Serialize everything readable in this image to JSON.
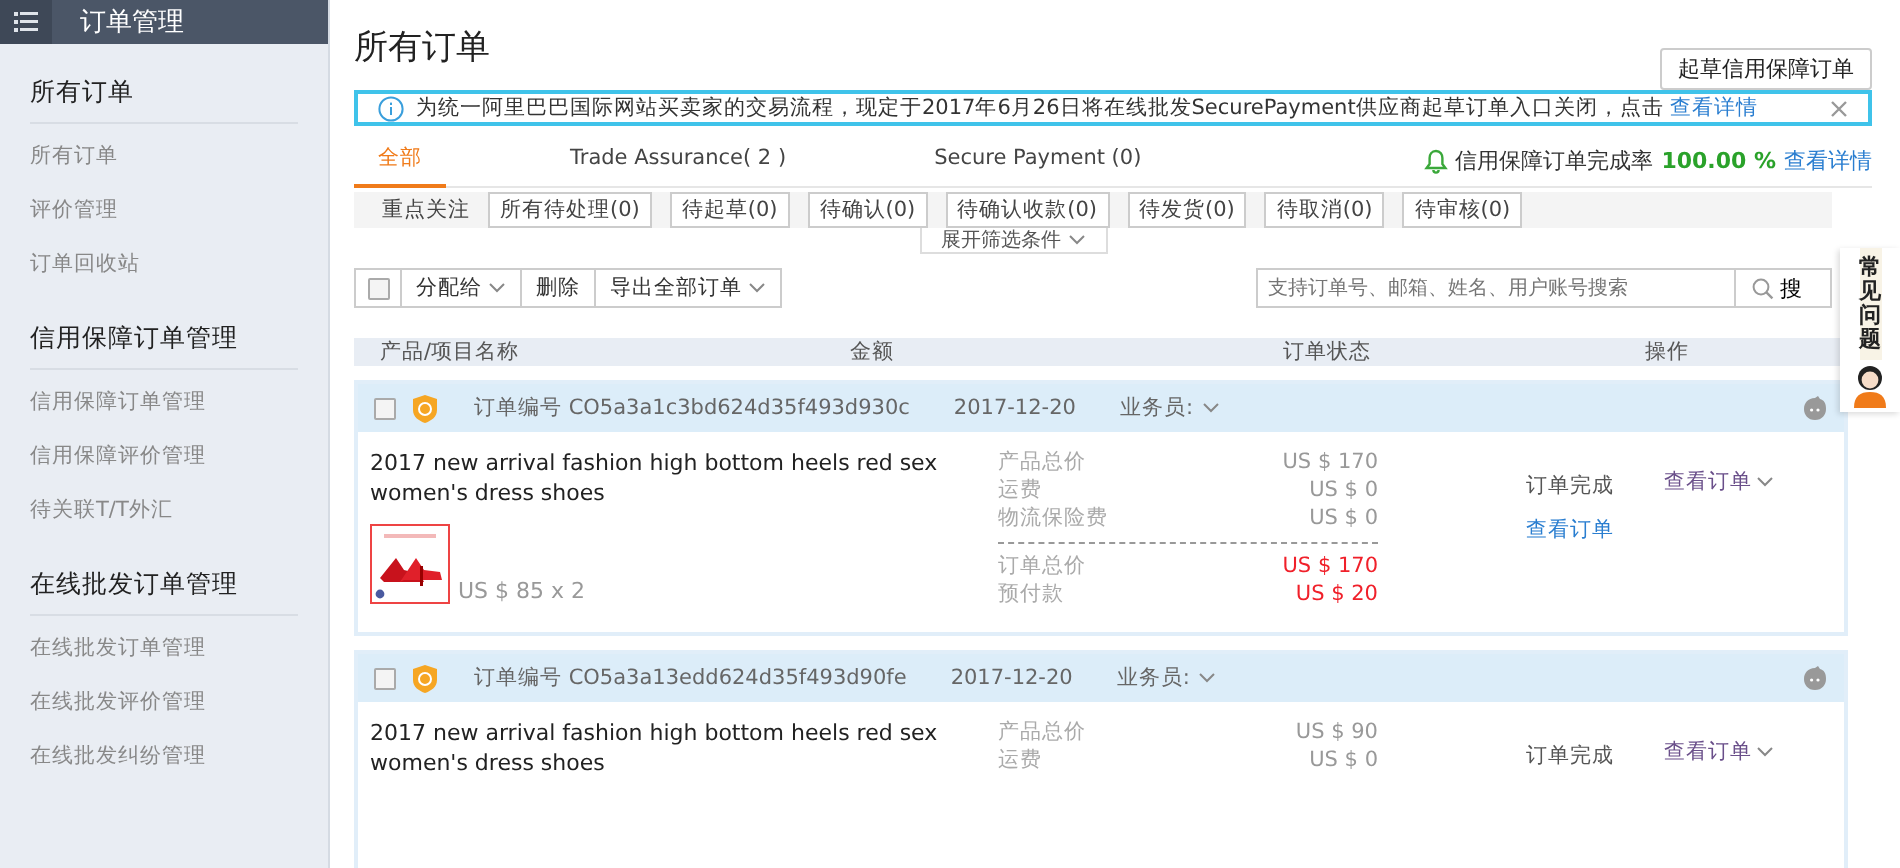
{
  "sidebar": {
    "title": "订单管理",
    "sections": [
      {
        "heading": "所有订单",
        "items": [
          "所有订单",
          "评价管理",
          "订单回收站"
        ]
      },
      {
        "heading": "信用保障订单管理",
        "items": [
          "信用保障订单管理",
          "信用保障评价管理",
          "待关联T/T外汇"
        ]
      },
      {
        "heading": "在线批发订单管理",
        "items": [
          "在线批发订单管理",
          "在线批发评价管理",
          "在线批发纠纷管理"
        ]
      }
    ]
  },
  "page_title": "所有订单",
  "draft_button": "起草信用保障订单",
  "notice": {
    "text": "为统一阿里巴巴国际网站买卖家的交易流程，现定于2017年6月26日将在线批发SecurePayment供应商起草订单入口关闭，点击",
    "link": "查看详情"
  },
  "tabs": [
    {
      "label": "全部",
      "selected": true
    },
    {
      "label": "Trade Assurance( 2 )",
      "selected": false
    },
    {
      "label": "Secure Payment (0)",
      "selected": false
    }
  ],
  "completion": {
    "label": "信用保障订单完成率",
    "value": "100.00 %",
    "link": "查看详情"
  },
  "filters": {
    "label": "重点关注",
    "chips": [
      "所有待处理(0)",
      "待起草(0)",
      "待确认(0)",
      "待确认收款(0)",
      "待发货(0)",
      "待取消(0)",
      "待审核(0)"
    ]
  },
  "expand_filters": "展开筛选条件",
  "select_all_checked": false,
  "toolbar": [
    {
      "label": "分配给",
      "has_caret": true
    },
    {
      "label": "删除",
      "has_caret": false
    },
    {
      "label": "导出全部订单",
      "has_caret": true
    }
  ],
  "search": {
    "placeholder": "支持订单号、邮箱、姓名、用户账号搜索",
    "button": "搜"
  },
  "help_widget": "常见问题",
  "columns": [
    "产品/项目名称",
    "金额",
    "订单状态",
    "操作"
  ],
  "orders": [
    {
      "number": "订单编号 CO5a3a1c3bd624d35f493d930c",
      "date": "2017-12-20",
      "salesperson": "业务员:",
      "title": "2017 new arrival fashion high bottom heels red sex women's dress shoes",
      "checked": false,
      "unit_price": "US $ 85 x 2",
      "amounts": [
        {
          "label": "产品总价",
          "value": "US $ 170",
          "kind": "normal"
        },
        {
          "label": "运费",
          "value": "US $ 0",
          "kind": "normal"
        },
        {
          "label": "物流保险费",
          "value": "US $ 0",
          "kind": "normal"
        },
        {
          "label": "订单总价",
          "value": "US $ 170",
          "kind": "total"
        },
        {
          "label": "预付款",
          "value": "US $ 20",
          "kind": "total"
        }
      ],
      "status": "订单完成",
      "status_link": "查看订单",
      "action": "查看订单"
    },
    {
      "number": "订单编号 CO5a3a13edd624d35f493d90fe",
      "date": "2017-12-20",
      "salesperson": "业务员:",
      "title": "2017 new arrival fashion high bottom heels red sex women's dress shoes",
      "checked": false,
      "amounts": [
        {
          "label": "产品总价",
          "value": "US $ 90",
          "kind": "normal"
        },
        {
          "label": "运费",
          "value": "US $ 0",
          "kind": "normal"
        }
      ],
      "status": "订单完成",
      "action": "查看订单"
    }
  ]
}
